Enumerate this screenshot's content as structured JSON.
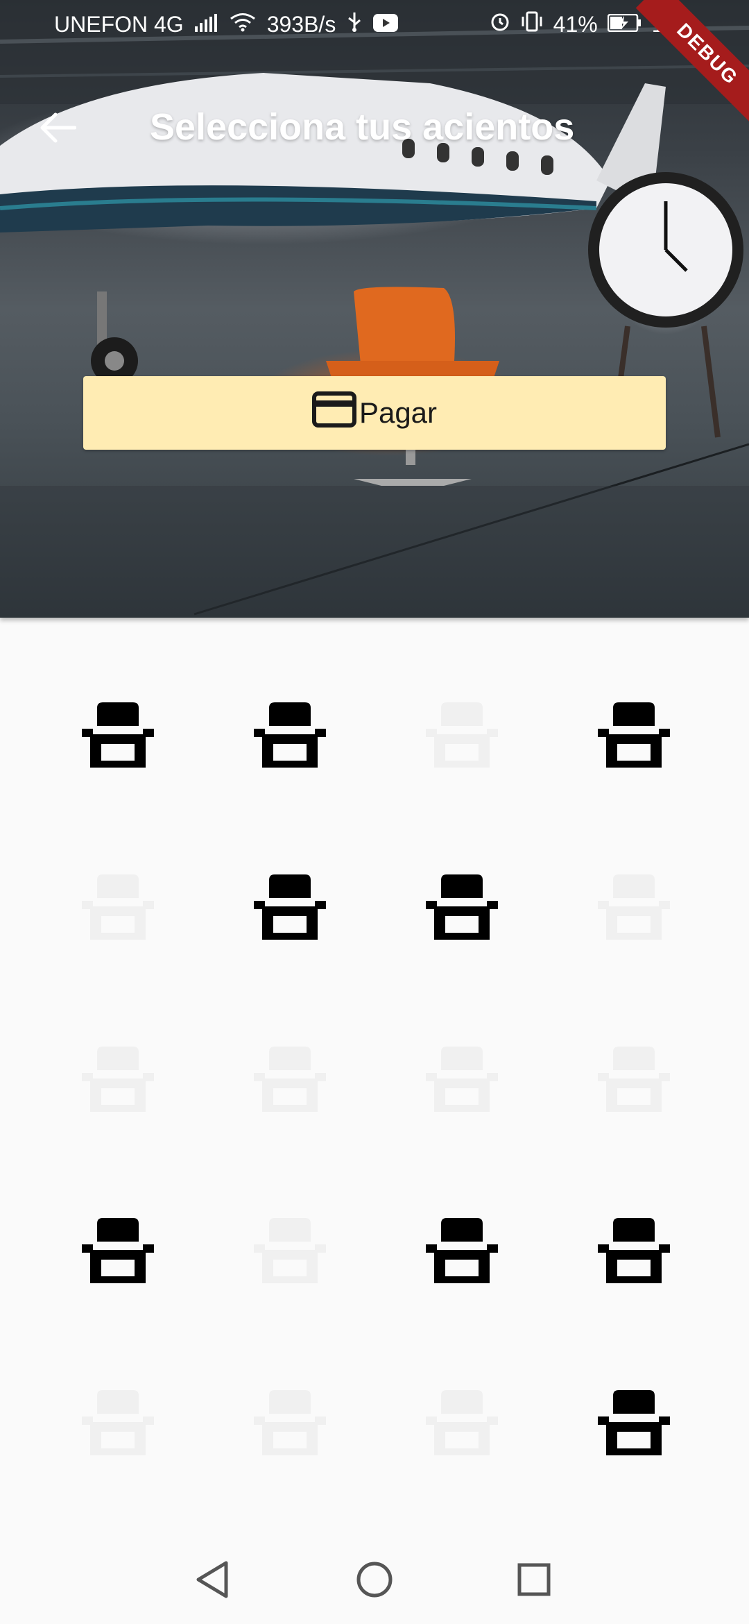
{
  "status_bar": {
    "carrier": "UNEFON 4G",
    "net_speed": "393B/s",
    "battery": "41%",
    "time": "1:16"
  },
  "debug_banner": "DEBUG",
  "app_bar": {
    "title": "Selecciona tus acientos",
    "back_icon": "arrow-back-icon"
  },
  "pay_button": {
    "label": "Pagar",
    "icon": "credit-card-icon"
  },
  "seats": {
    "rows": [
      [
        true,
        true,
        false,
        true
      ],
      [
        false,
        true,
        true,
        false
      ],
      [
        false,
        false,
        false,
        false
      ],
      [
        true,
        false,
        true,
        true
      ],
      [
        false,
        false,
        false,
        true
      ]
    ]
  },
  "nav": {
    "back_icon": "triangle-back-icon",
    "home_icon": "circle-home-icon",
    "recents_icon": "square-recents-icon"
  },
  "colors": {
    "pay_button_bg": "#ffecb3",
    "seat_available": "#000000",
    "seat_unavailable": "#f0f0f0",
    "debug_ribbon": "#a51c1c"
  }
}
